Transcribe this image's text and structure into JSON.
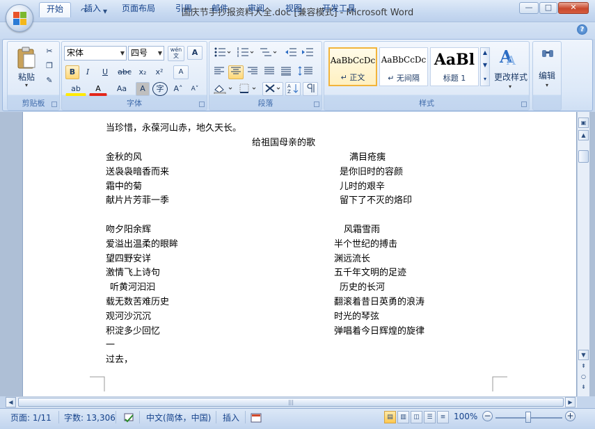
{
  "window": {
    "title": "国庆节手抄报资料大全.doc [兼容模式] - Microsoft Word",
    "minimize": "—",
    "maximize": "□",
    "close": "✕"
  },
  "qat": {
    "save": "▣",
    "undo": "↶",
    "redo": "↷",
    "customize": "▾"
  },
  "tabs": [
    "开始",
    "插入",
    "页面布局",
    "引用",
    "邮件",
    "审阅",
    "视图",
    "开发工具"
  ],
  "help": "?",
  "ribbon": {
    "clipboard": {
      "label": "剪贴板",
      "paste": "粘贴",
      "cut_icon": "✂",
      "copy_icon": "❐",
      "painter_icon": "✎"
    },
    "font": {
      "label": "字体",
      "font_name": "宋体",
      "font_size": "四号",
      "bold": "B",
      "italic": "I",
      "underline": "U",
      "strike": "abc",
      "subscript": "x₂",
      "superscript": "x²",
      "highlight": "ab",
      "color": "A",
      "case": "Aa",
      "shading": "A",
      "enclose": "字",
      "grow": "A˄",
      "shrink": "A˅",
      "wen": "wén\n文",
      "border": "A",
      "clear": "A"
    },
    "paragraph": {
      "label": "段落"
    },
    "styles": {
      "label": "样式",
      "items": [
        {
          "sample": "AaBbCcDc",
          "name": "↵ 正文"
        },
        {
          "sample": "AaBbCcDc",
          "name": "↵ 无间隔"
        },
        {
          "sample": "AaBl",
          "name": "标题 1"
        }
      ],
      "change": "更改样式"
    },
    "editing": {
      "label": "编辑",
      "find_icon": "๏"
    }
  },
  "document": {
    "lines": [
      {
        "left": "当珍惜，永葆河山赤，地久天长。",
        "right": ""
      },
      {
        "center": "给祖国母亲的歌"
      },
      {
        "left": "金秋的风",
        "right": "满目疮痍"
      },
      {
        "left": "送袅袅暗香而来",
        "right": "是你旧时的容颜"
      },
      {
        "left": "霜中的菊",
        "right": "儿时的艰辛"
      },
      {
        "left": "献片片芳菲一季",
        "right": "留下了不灭的烙印"
      },
      {
        "left": "吻夕阳余辉",
        "right": "风霜雪雨"
      },
      {
        "left": "爱溢出温柔的眼眸",
        "right": "半个世纪的搏击"
      },
      {
        "left": "望四野安详",
        "right": "渊远流长"
      },
      {
        "left": "激情飞上诗句",
        "right": "五千年文明的足迹"
      },
      {
        "left": "听黄河汩汩",
        "right": "历史的长河"
      },
      {
        "left": "载无数苦难历史",
        "right": "翻滚着昔日英勇的浪涛"
      },
      {
        "left": "观河沙沉沉",
        "right": "时光的琴弦"
      },
      {
        "left": "积淀多少回忆",
        "right": "弹唱着今日辉煌的旋律"
      },
      {
        "left": "一",
        "right": ""
      },
      {
        "left": "过去，",
        "right": ""
      }
    ]
  },
  "status": {
    "page": "页面: 1/11",
    "words": "字数: 13,306",
    "language": "中文(简体，中国)",
    "mode": "插入",
    "zoom": "100%",
    "zoom_out": "−",
    "zoom_in": "+"
  }
}
